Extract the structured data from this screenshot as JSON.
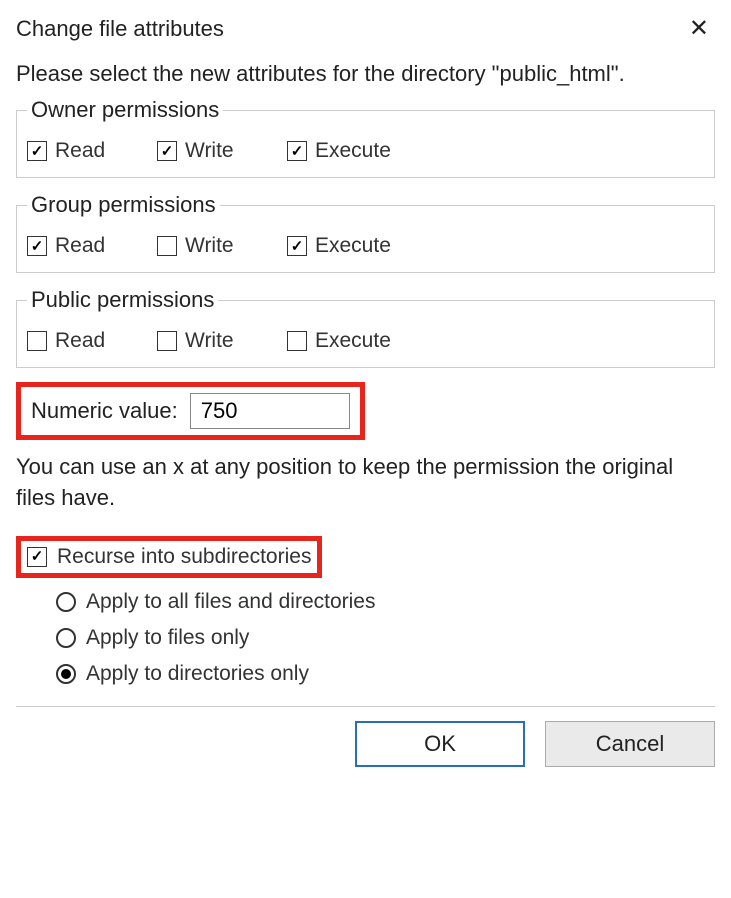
{
  "title": "Change file attributes",
  "instruction": "Please select the new attributes for the directory \"public_html\".",
  "permissions": {
    "owner": {
      "legend": "Owner permissions",
      "read": {
        "label": "Read",
        "checked": true
      },
      "write": {
        "label": "Write",
        "checked": true
      },
      "execute": {
        "label": "Execute",
        "checked": true
      }
    },
    "group": {
      "legend": "Group permissions",
      "read": {
        "label": "Read",
        "checked": true
      },
      "write": {
        "label": "Write",
        "checked": false
      },
      "execute": {
        "label": "Execute",
        "checked": true
      }
    },
    "public": {
      "legend": "Public permissions",
      "read": {
        "label": "Read",
        "checked": false
      },
      "write": {
        "label": "Write",
        "checked": false
      },
      "execute": {
        "label": "Execute",
        "checked": false
      }
    }
  },
  "numeric": {
    "label": "Numeric value:",
    "value": "750"
  },
  "hint": "You can use an x at any position to keep the permission the original files have.",
  "recurse": {
    "label": "Recurse into subdirectories",
    "checked": true
  },
  "apply_options": {
    "all": {
      "label": "Apply to all files and directories",
      "selected": false
    },
    "files": {
      "label": "Apply to files only",
      "selected": false
    },
    "dirs": {
      "label": "Apply to directories only",
      "selected": true
    }
  },
  "buttons": {
    "ok": "OK",
    "cancel": "Cancel"
  },
  "highlights": {
    "numeric": true,
    "recurse": true
  }
}
